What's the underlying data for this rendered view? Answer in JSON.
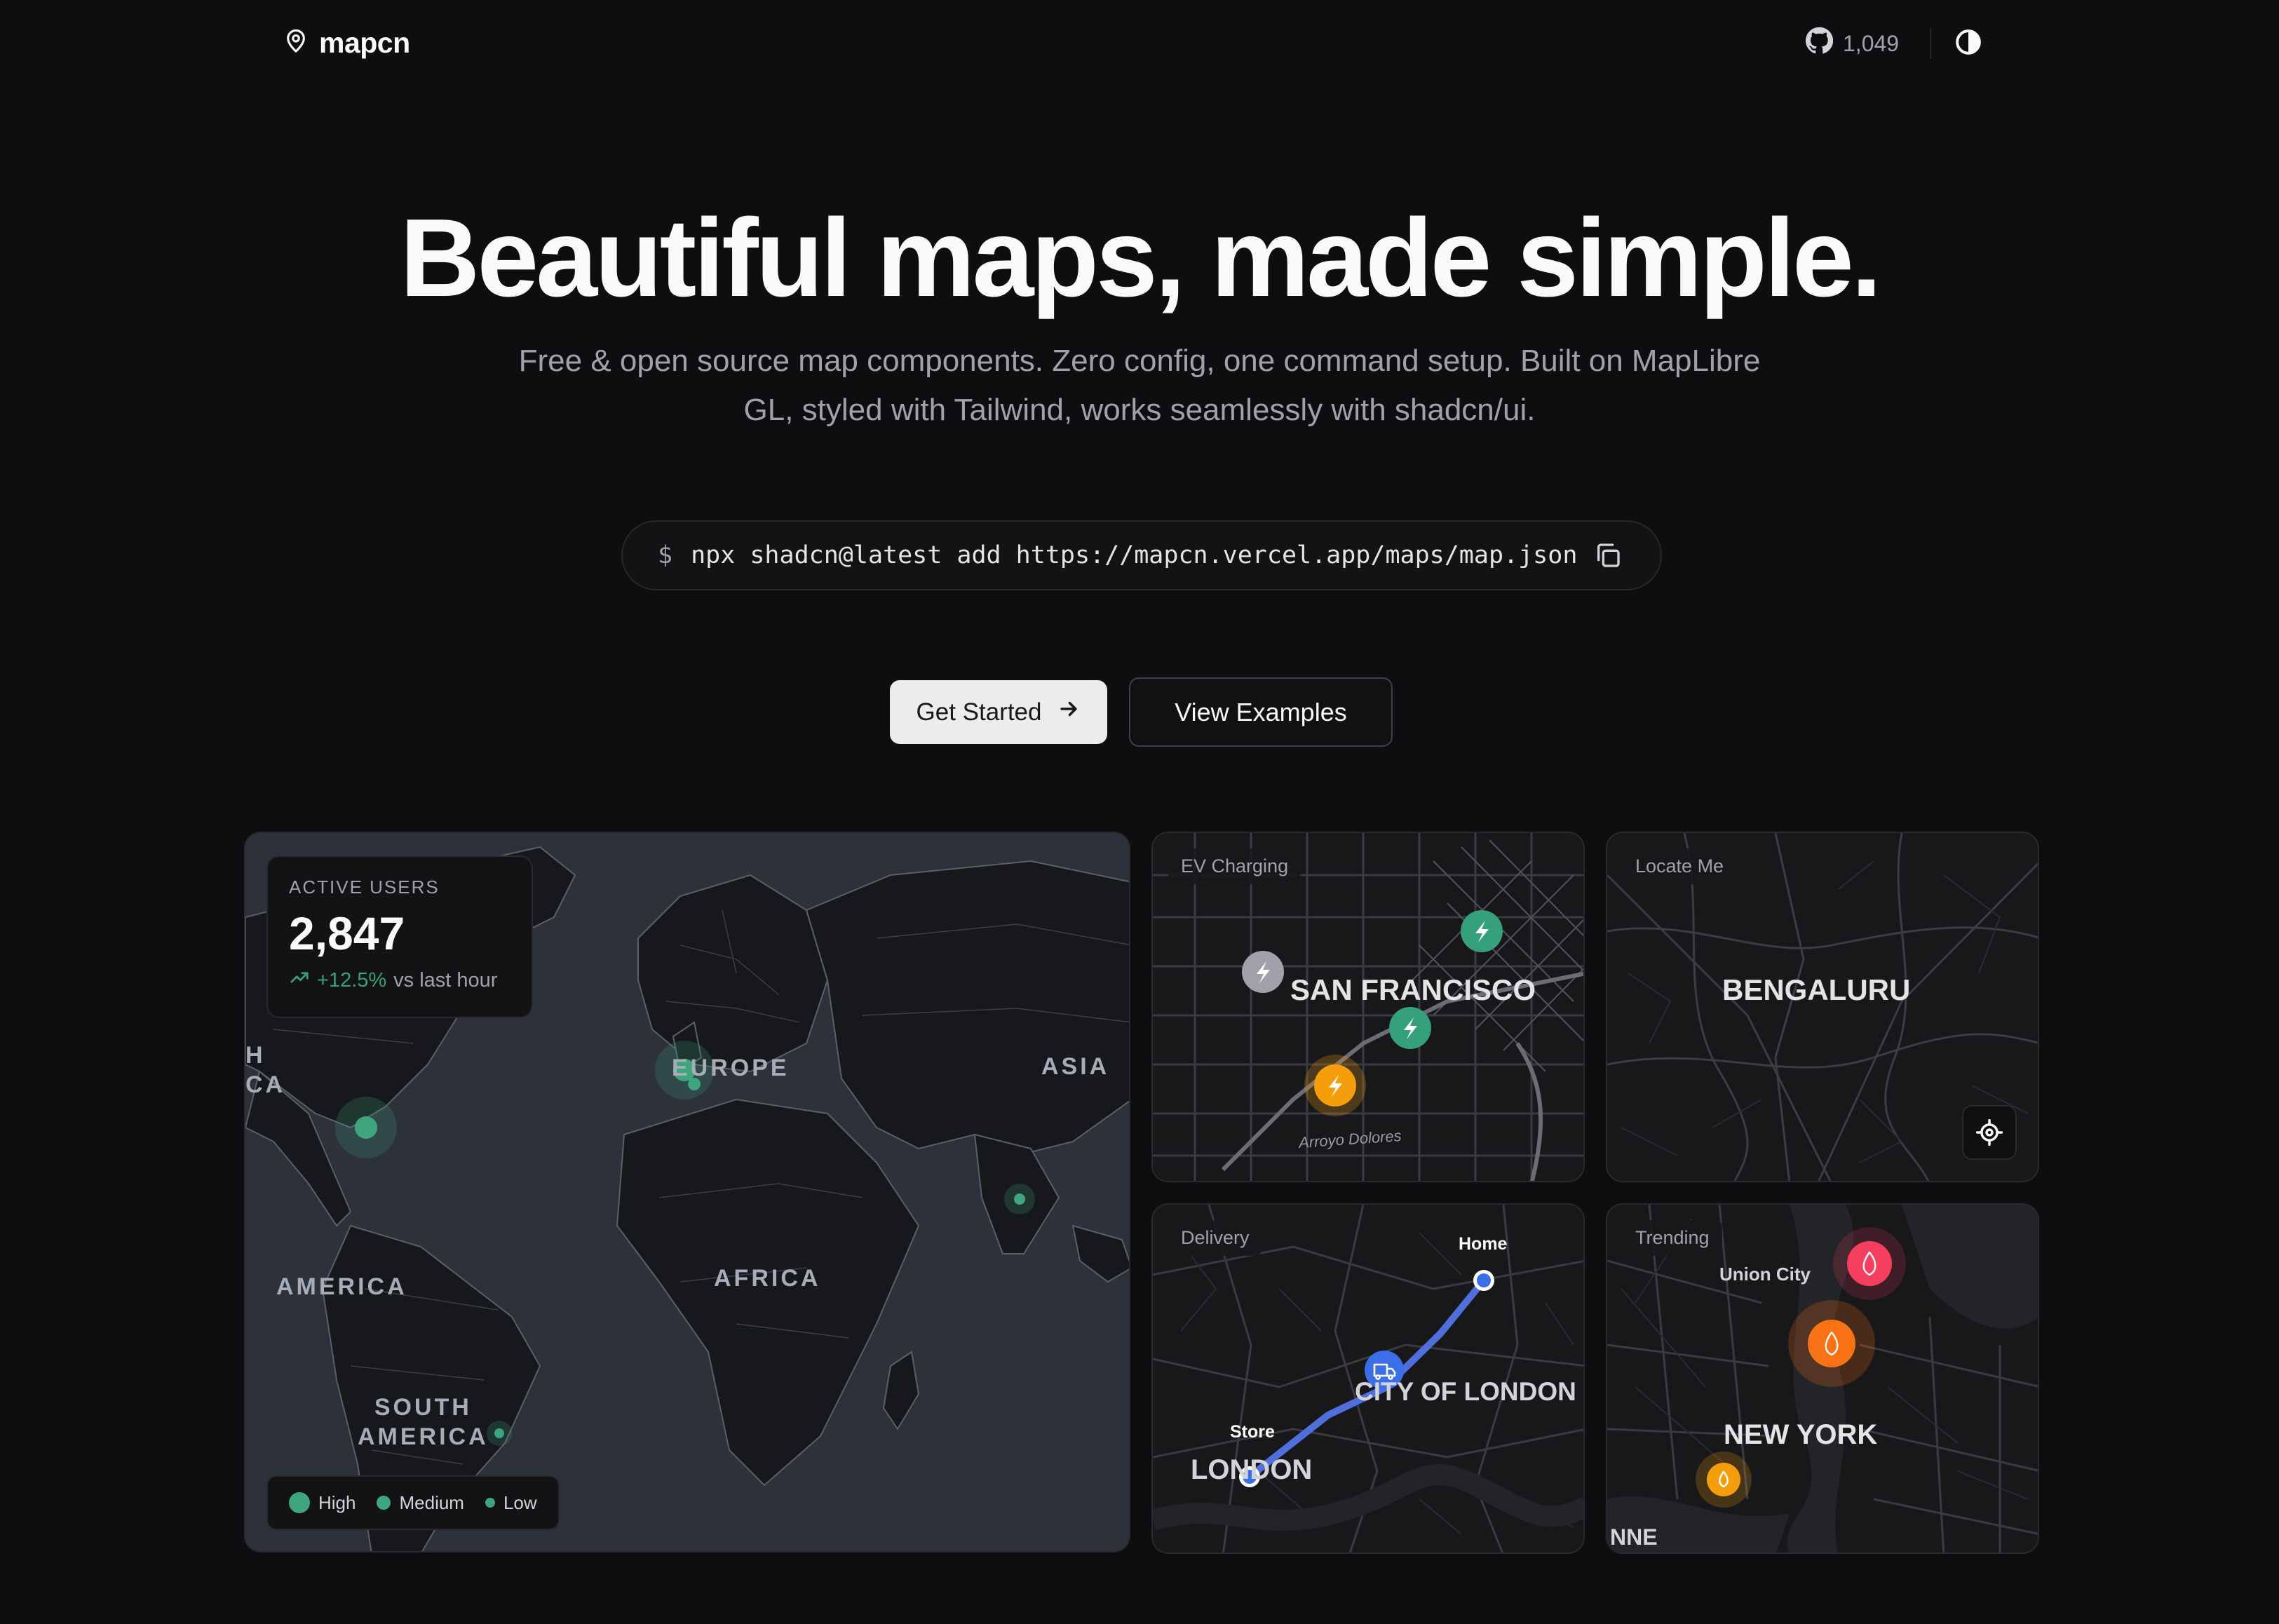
{
  "header": {
    "brand": "mapcn",
    "github_stars": "1,049"
  },
  "hero": {
    "title": "Beautiful maps, made simple.",
    "subtitle": "Free & open source map components. Zero config, one command setup. Built on MapLibre GL, styled with Tailwind, works seamlessly with shadcn/ui."
  },
  "command": {
    "prompt": "$",
    "text": "npx shadcn@latest add https://mapcn.vercel.app/maps/map.json"
  },
  "buttons": {
    "get_started": "Get Started",
    "view_examples": "View Examples"
  },
  "world_card": {
    "users_label": "ACTIVE USERS",
    "users_value": "2,847",
    "users_change": "+12.5%",
    "users_compare": "vs last hour",
    "regions": {
      "north_america_a": "H",
      "north_america_b": "CA",
      "europe": "EUROPE",
      "asia": "ASIA",
      "america": "AMERICA",
      "africa": "AFRICA",
      "south_america": "SOUTH\nAMERICA"
    },
    "legend": [
      "High",
      "Medium",
      "Low"
    ],
    "accent_color": "#3fa57f"
  },
  "ev_card": {
    "tag": "EV Charging",
    "city": "SAN FRANCISCO",
    "street": "Arroyo Dolores"
  },
  "locate_card": {
    "tag": "Locate Me",
    "city": "BENGALURU"
  },
  "delivery_card": {
    "tag": "Delivery",
    "home": "Home",
    "store": "Store",
    "district": "CITY OF LONDON",
    "city": "LONDON"
  },
  "trending_card": {
    "tag": "Trending",
    "union_city": "Union City",
    "city": "NEW YORK",
    "edge_label": "NNE"
  }
}
